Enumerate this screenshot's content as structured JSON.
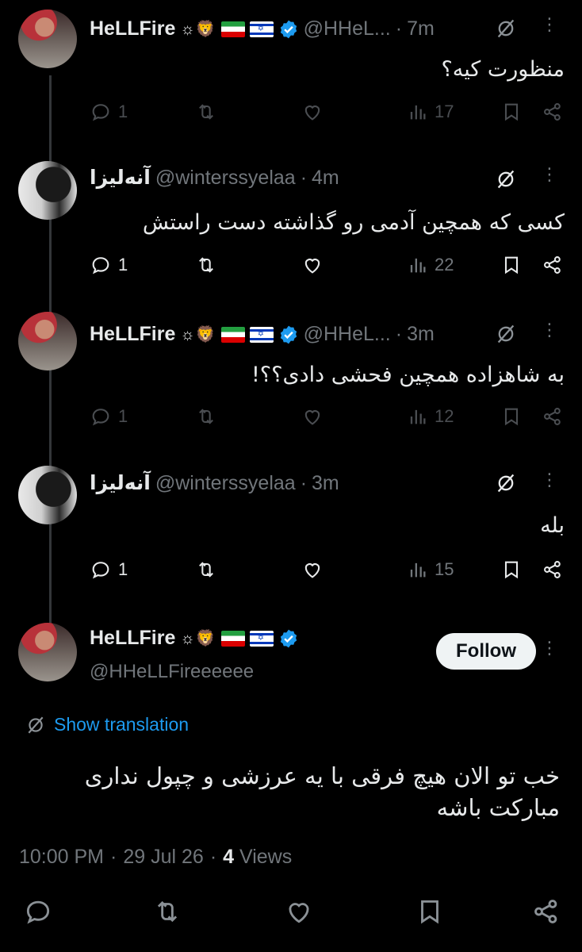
{
  "tweets": [
    {
      "name": "HeLLFire",
      "handle": "@HHeL...",
      "time": "7m",
      "text": "منظورت کیه؟",
      "reply_count": "1",
      "views": "17",
      "dim": true
    },
    {
      "name": "آنه‌لیزا",
      "handle": "@winterssyelaa",
      "time": "4m",
      "text": "کسی که همچین آدمی رو گذاشته دست راستش",
      "reply_count": "1",
      "views": "22",
      "dim": false
    },
    {
      "name": "HeLLFire",
      "handle": "@HHeL...",
      "time": "3m",
      "text": "به شاهزاده همچین فحشی دادی؟؟!",
      "reply_count": "1",
      "views": "12",
      "dim": true
    },
    {
      "name": "آنه‌لیزا",
      "handle": "@winterssyelaa",
      "time": "3m",
      "text": "بله",
      "reply_count": "1",
      "views": "15",
      "dim": false
    }
  ],
  "main": {
    "name": "HeLLFire",
    "handle": "@HHeLLFireeeeee",
    "follow_label": "Follow",
    "show_translation": "Show translation",
    "text_line1": "خب تو الان هیچ فرقی با یه عرزشی و چپول نداری",
    "text_line2": "مبارکت باشه",
    "time": "10:00 PM",
    "date": "29 Jul 26",
    "views_count": "4",
    "views_label": "Views"
  },
  "separator": "·",
  "icons": {
    "reply": "reply-icon",
    "retweet": "retweet-icon",
    "like": "like-icon",
    "views": "views-icon",
    "bookmark": "bookmark-icon",
    "share": "share-icon",
    "grok": "grok-icon",
    "more": "more-icon",
    "verified": "verified-badge-icon"
  },
  "colors": {
    "background": "#000000",
    "text": "#e7e9ea",
    "muted": "#71767b",
    "accent": "#1d9bf0",
    "follow_bg": "#eff3f4"
  }
}
